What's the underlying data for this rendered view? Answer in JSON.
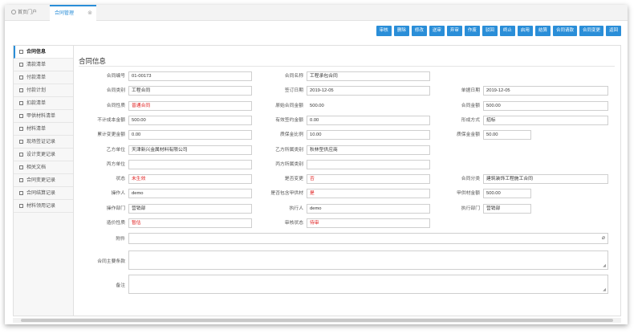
{
  "tabs": [
    {
      "label": "首页门户"
    },
    {
      "label": "合同管理"
    }
  ],
  "toolbar": [
    "审核",
    "删除",
    "修改",
    "送审",
    "弃审",
    "作废",
    "驳回",
    "终止",
    "启用",
    "结算",
    "合同请款",
    "合同变更",
    "返回"
  ],
  "sidebar": [
    "合同信息",
    "清款清单",
    "付款清单",
    "付款计划",
    "扣款清单",
    "甲供材料清单",
    "材料清单",
    "现场签证记录",
    "设计变更记录",
    "相关文档",
    "合同变更记录",
    "合同结算记录",
    "材料领用记录"
  ],
  "title": "合同信息",
  "fields": {
    "contract_no": {
      "label": "合同编号",
      "value": "01-00173"
    },
    "contract_name": {
      "label": "合同名称",
      "value": "工程承包合同"
    },
    "contract_type": {
      "label": "合同类别",
      "value": "工程合同"
    },
    "sign_date": {
      "label": "签订日期",
      "value": "2019-12-05"
    },
    "report_date": {
      "label": "单据日期",
      "value": "2019-12-05"
    },
    "contract_nature": {
      "label": "合同性质",
      "value": "普通合同"
    },
    "original_amount": {
      "label": "原始合同金额",
      "value": "500.00"
    },
    "contract_amount": {
      "label": "合同金额",
      "value": "500.00"
    },
    "cost_amount": {
      "label": "不计成本金额",
      "value": "500.00"
    },
    "valid_amount": {
      "label": "有效签约金额",
      "value": "0.00"
    },
    "form_method": {
      "label": "形成方式",
      "value": "招标"
    },
    "change_amount": {
      "label": "累计变更金额",
      "value": "0.00"
    },
    "warranty_ratio": {
      "label": "质保金比例",
      "value": "10.00"
    },
    "warranty_amount": {
      "label": "质保金金额",
      "value": "50.00"
    },
    "party_b": {
      "label": "乙方单位",
      "value": "天津新兴金属材料有限公司"
    },
    "party_b_type": {
      "label": "乙方所属类别",
      "value": "秋林型供应商"
    },
    "party_c": {
      "label": "丙方单位",
      "value": ""
    },
    "party_c_type": {
      "label": "丙方所属类别",
      "value": ""
    },
    "status": {
      "label": "状态",
      "value": "未生效"
    },
    "is_changed": {
      "label": "是否变更",
      "value": "否"
    },
    "category": {
      "label": "合同分类",
      "value": "建筑装饰工程施工合同"
    },
    "operator": {
      "label": "操作人",
      "value": "demo"
    },
    "include_material": {
      "label": "是否包含甲供材",
      "value": "是"
    },
    "material_amount": {
      "label": "甲供材金额",
      "value": "500.00"
    },
    "operate_dept": {
      "label": "操作部门",
      "value": "营销部"
    },
    "executor": {
      "label": "执行人",
      "value": "demo"
    },
    "exec_dept": {
      "label": "执行部门",
      "value": "营销部"
    },
    "price_nature": {
      "label": "造价性质",
      "value": "暂估"
    },
    "audit_status": {
      "label": "审核状态",
      "value": "待审"
    }
  },
  "attachment_label": "附件",
  "main_terms_label": "合同主要条款",
  "remark_label": "备注"
}
